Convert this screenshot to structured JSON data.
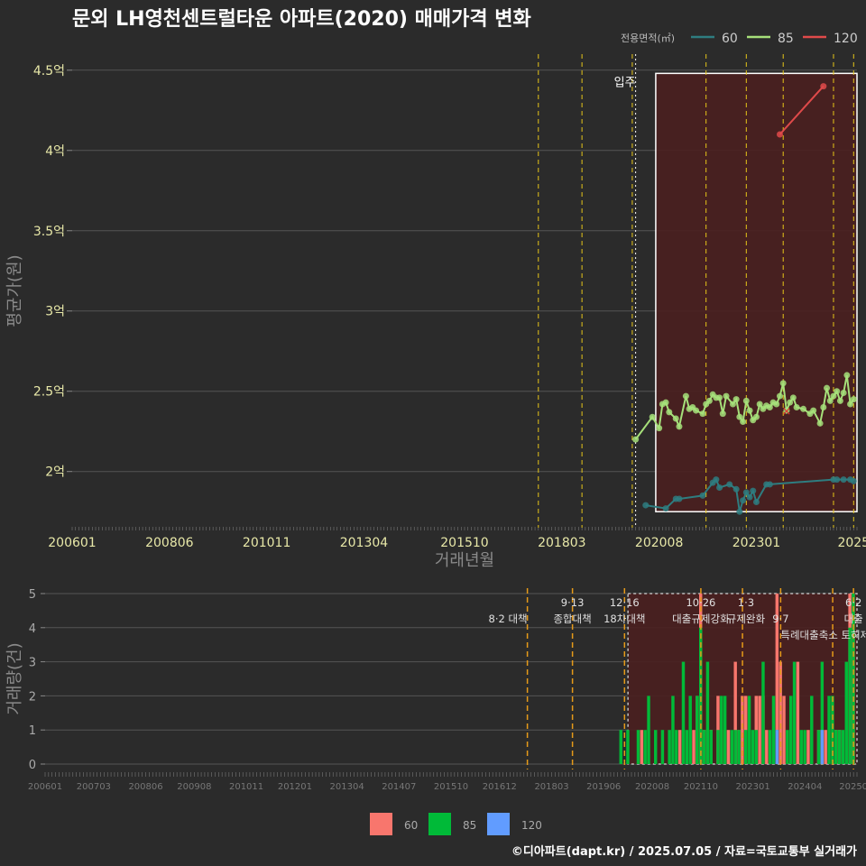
{
  "title": "문외 LH영천센트럴타운 아파트(2020) 매매가격 변화",
  "footer": "©디아파트(dapt.kr) / 2025.07.05 / 자료=국토교통부 실거래가",
  "colors": {
    "background": "#2b2b2b",
    "grid": "#555555",
    "axis_text_main": "#e8e8a8",
    "axis_title": "#8a8a8a",
    "line_60": "#2e7d80",
    "line_85": "#a6e07a",
    "line_120": "#e04a4a",
    "bar_60": "#f8766d",
    "bar_85": "#00ba38",
    "bar_120": "#619cff",
    "policy_line": "#e6c619",
    "policy_line_bottom": "#e69a19",
    "shade": "#4a1f1f"
  },
  "chart_data": [
    {
      "type": "line",
      "name": "price",
      "ylabel": "평균가(원)",
      "xlabel": "거래년월",
      "ylim": [
        1.65,
        4.6
      ],
      "xlim": [
        "2006-01",
        "2025-07"
      ],
      "y_ticks": [
        {
          "v": 2.0,
          "label": "2억"
        },
        {
          "v": 2.5,
          "label": "2.5억"
        },
        {
          "v": 3.0,
          "label": "3억"
        },
        {
          "v": 3.5,
          "label": "3.5억"
        },
        {
          "v": 4.0,
          "label": "4억"
        },
        {
          "v": 4.5,
          "label": "4.5억"
        }
      ],
      "x_ticks": [
        {
          "d": "2006-01",
          "label": "200601"
        },
        {
          "d": "2008-06",
          "label": "200806"
        },
        {
          "d": "2010-11",
          "label": "201011"
        },
        {
          "d": "2013-04",
          "label": "201304"
        },
        {
          "d": "2015-10",
          "label": "201510"
        },
        {
          "d": "2018-03",
          "label": "201803"
        },
        {
          "d": "2020-08",
          "label": "202008"
        },
        {
          "d": "2023-01",
          "label": "202301"
        },
        {
          "d": "2025-06",
          "label": "2025"
        }
      ],
      "legend_title": "전용면적(㎡)",
      "legend": [
        "60",
        "85",
        "120"
      ],
      "policy_dates": [
        "2017-08",
        "2018-09",
        "2019-12",
        "2021-10",
        "2022-10",
        "2023-09",
        "2024-12",
        "2025-06"
      ],
      "move_in": {
        "date": "2020-01",
        "label": "입주"
      },
      "highlight_box": {
        "from": "2020-07",
        "to": "2025-07",
        "ymin": 1.75,
        "ymax": 4.48
      },
      "series": [
        {
          "name": "60",
          "x": [
            "2020-04",
            "2020-10",
            "2021-01",
            "2021-02",
            "2021-09",
            "2021-12",
            "2022-01",
            "2022-02",
            "2022-05",
            "2022-07",
            "2022-08",
            "2022-09",
            "2022-10",
            "2022-11",
            "2022-12",
            "2023-01",
            "2023-04",
            "2023-05",
            "2024-12",
            "2025-01",
            "2025-03",
            "2025-05",
            "2025-06"
          ],
          "y": [
            1.79,
            1.77,
            1.83,
            1.83,
            1.85,
            1.93,
            1.95,
            1.9,
            1.92,
            1.89,
            1.75,
            1.82,
            1.87,
            1.84,
            1.88,
            1.81,
            1.92,
            1.92,
            1.95,
            1.95,
            1.95,
            1.95,
            1.94
          ]
        },
        {
          "name": "85",
          "x": [
            "2020-01",
            "2020-06",
            "2020-08",
            "2020-09",
            "2020-10",
            "2020-11",
            "2021-01",
            "2021-02",
            "2021-04",
            "2021-05",
            "2021-06",
            "2021-07",
            "2021-09",
            "2021-10",
            "2021-11",
            "2021-12",
            "2022-01",
            "2022-02",
            "2022-03",
            "2022-04",
            "2022-06",
            "2022-07",
            "2022-08",
            "2022-09",
            "2022-10",
            "2022-11",
            "2022-12",
            "2023-01",
            "2023-02",
            "2023-03",
            "2023-04",
            "2023-05",
            "2023-06",
            "2023-07",
            "2023-08",
            "2023-09",
            "2023-10",
            "2023-11",
            "2023-12",
            "2024-01",
            "2024-03",
            "2024-05",
            "2024-06",
            "2024-08",
            "2024-09",
            "2024-10",
            "2024-11",
            "2024-12",
            "2025-01",
            "2025-02",
            "2025-03",
            "2025-04",
            "2025-05",
            "2025-06"
          ],
          "y": [
            2.2,
            2.34,
            2.27,
            2.42,
            2.43,
            2.37,
            2.33,
            2.28,
            2.47,
            2.39,
            2.4,
            2.38,
            2.36,
            2.42,
            2.44,
            2.48,
            2.46,
            2.46,
            2.36,
            2.47,
            2.42,
            2.45,
            2.34,
            2.31,
            2.44,
            2.38,
            2.32,
            2.34,
            2.42,
            2.39,
            2.41,
            2.4,
            2.43,
            2.42,
            2.47,
            2.55,
            2.38,
            2.43,
            2.46,
            2.4,
            2.39,
            2.36,
            2.38,
            2.3,
            2.4,
            2.52,
            2.44,
            2.47,
            2.5,
            2.44,
            2.49,
            2.6,
            2.42,
            2.45
          ]
        },
        {
          "name": "120",
          "x": [
            "2023-08",
            "2024-09"
          ],
          "y": [
            4.1,
            4.4
          ]
        }
      ],
      "markers": [
        {
          "x": "2023-10",
          "y": 2.38,
          "symbol": "×"
        }
      ]
    },
    {
      "type": "bar",
      "name": "volume",
      "ylabel": "거래량(건)",
      "ylim": [
        0,
        5
      ],
      "y_ticks": [
        0,
        1,
        2,
        3,
        4,
        5
      ],
      "x_ticks": [
        {
          "d": "2006-01",
          "label": "200601"
        },
        {
          "d": "2007-03",
          "label": "200703"
        },
        {
          "d": "2008-06",
          "label": "200806"
        },
        {
          "d": "2009-08",
          "label": "200908"
        },
        {
          "d": "2010-11",
          "label": "201011"
        },
        {
          "d": "2012-01",
          "label": "201201"
        },
        {
          "d": "2013-04",
          "label": "201304"
        },
        {
          "d": "2014-07",
          "label": "201407"
        },
        {
          "d": "2015-10",
          "label": "201510"
        },
        {
          "d": "2016-12",
          "label": "201612"
        },
        {
          "d": "2018-03",
          "label": "201803"
        },
        {
          "d": "2019-06",
          "label": "201906"
        },
        {
          "d": "2020-08",
          "label": "202008"
        },
        {
          "d": "2021-10",
          "label": "202110"
        },
        {
          "d": "2023-01",
          "label": "202301"
        },
        {
          "d": "2024-04",
          "label": "202404"
        },
        {
          "d": "2025-06",
          "label": "20250"
        }
      ],
      "policy_dates": [
        "2017-08",
        "2018-09",
        "2019-12",
        "2021-10",
        "2022-10",
        "2023-09",
        "2024-12",
        "2025-06"
      ],
      "policy_labels": [
        {
          "d": "2017-08",
          "label": "8·2 대책",
          "row": 1,
          "align": "end"
        },
        {
          "d": "2018-09",
          "label": "9·13",
          "row": 0,
          "align": "middle"
        },
        {
          "d": "2018-09",
          "label": "종합대책",
          "row": 1,
          "align": "middle"
        },
        {
          "d": "2019-12",
          "label": "12·16",
          "row": 0,
          "align": "middle"
        },
        {
          "d": "2019-12",
          "label": "18차대책",
          "row": 1,
          "align": "middle"
        },
        {
          "d": "2021-10",
          "label": "10·26",
          "row": 0,
          "align": "middle"
        },
        {
          "d": "2021-10",
          "label": "대출규제강화",
          "row": 1,
          "align": "middle"
        },
        {
          "d": "2022-11",
          "label": "1·3",
          "row": 0,
          "align": "middle"
        },
        {
          "d": "2022-11",
          "label": "규제완화",
          "row": 1,
          "align": "middle"
        },
        {
          "d": "2023-09",
          "label": "9·7",
          "row": 1,
          "align": "middle"
        },
        {
          "d": "2023-09",
          "label": "특례대출축소 토허제 해",
          "row": 2,
          "align": "start"
        },
        {
          "d": "2025-06",
          "label": "6·2",
          "row": 0,
          "align": "middle"
        },
        {
          "d": "2025-06",
          "label": "대출",
          "row": 1,
          "align": "middle"
        }
      ],
      "legend": [
        "60",
        "85",
        "120"
      ],
      "highlight_box": {
        "from": "2020-01",
        "to": "2025-07",
        "ymin": 0,
        "ymax": 5
      },
      "series": [
        {
          "name": "60",
          "x": [
            "2020-05",
            "2021-04",
            "2021-08",
            "2021-09",
            "2021-10",
            "2021-11",
            "2022-01",
            "2022-03",
            "2022-05",
            "2022-06",
            "2022-08",
            "2022-09",
            "2022-10",
            "2022-11",
            "2023-02",
            "2023-03",
            "2023-04",
            "2023-05",
            "2023-08",
            "2023-09",
            "2023-10",
            "2024-02",
            "2024-05",
            "2024-08",
            "2024-10",
            "2025-01",
            "2025-02",
            "2025-05",
            "2025-06"
          ],
          "y": [
            1,
            1,
            1,
            2,
            5,
            1,
            1,
            2,
            1,
            1,
            3,
            1,
            2,
            2,
            2,
            2,
            2,
            1,
            5,
            3,
            2,
            3,
            1,
            1,
            1,
            1,
            1,
            5,
            5
          ]
        },
        {
          "name": "85",
          "x": [
            "2019-11",
            "2020-01",
            "2020-04",
            "2020-06",
            "2020-07",
            "2020-09",
            "2020-11",
            "2021-01",
            "2021-02",
            "2021-03",
            "2021-05",
            "2021-06",
            "2021-07",
            "2021-09",
            "2021-10",
            "2021-11",
            "2021-12",
            "2022-01",
            "2022-03",
            "2022-04",
            "2022-05",
            "2022-07",
            "2022-08",
            "2022-09",
            "2022-11",
            "2022-12",
            "2023-01",
            "2023-02",
            "2023-04",
            "2023-06",
            "2023-07",
            "2023-08",
            "2023-11",
            "2023-12",
            "2024-01",
            "2024-03",
            "2024-04",
            "2024-06",
            "2024-08",
            "2024-09",
            "2024-11",
            "2024-12",
            "2025-01",
            "2025-02",
            "2025-03",
            "2025-04",
            "2025-05",
            "2025-06"
          ],
          "y": [
            1,
            1,
            1,
            1,
            2,
            1,
            1,
            1,
            2,
            1,
            3,
            1,
            2,
            2,
            4,
            1,
            3,
            1,
            1,
            2,
            2,
            1,
            1,
            1,
            1,
            2,
            1,
            1,
            3,
            1,
            2,
            1,
            1,
            2,
            3,
            1,
            1,
            2,
            1,
            3,
            2,
            2,
            1,
            1,
            1,
            3,
            4,
            5
          ]
        },
        {
          "name": "120",
          "x": [
            "2023-08",
            "2024-09"
          ],
          "y": [
            1,
            1
          ]
        }
      ]
    }
  ]
}
